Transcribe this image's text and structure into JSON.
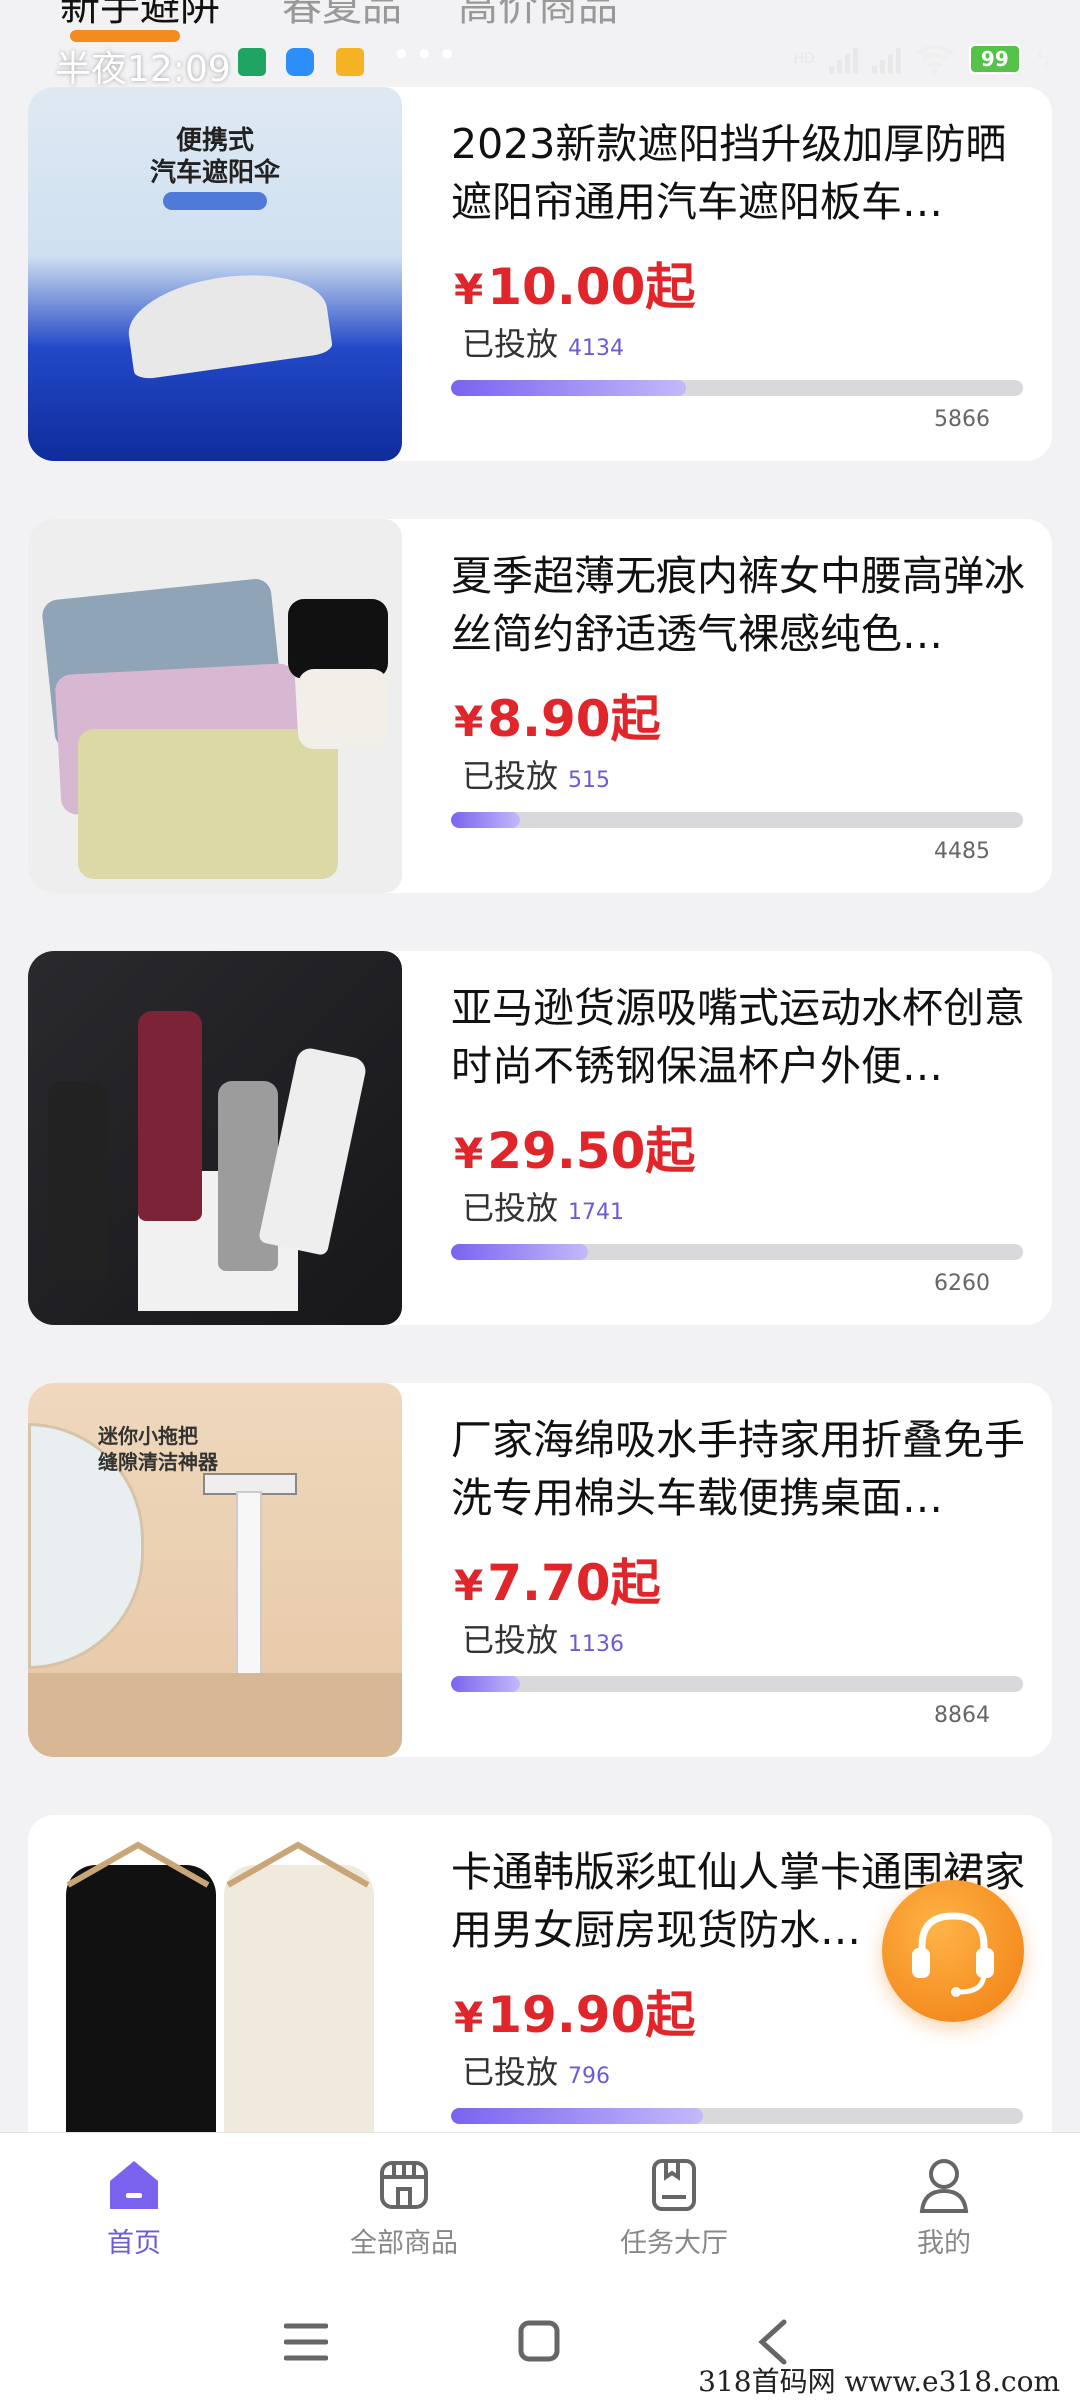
{
  "top_tabs": [
    {
      "label": "新手避阱",
      "active": true
    },
    {
      "label": "春夏品",
      "active": false
    },
    {
      "label": "高价商品",
      "active": false
    }
  ],
  "status_bar": {
    "time": "半夜12:09",
    "battery": "99",
    "network": "HD"
  },
  "products": [
    {
      "title": "2023新款遮阳挡升级加厚防晒遮阳帘通用汽车遮阳板车…",
      "price": "10.00起",
      "placed_label": "已投放",
      "placed_count": "4134",
      "total": "5866",
      "progress": 0.41,
      "image_text": "便携式\n汽车遮阳伞"
    },
    {
      "title": "夏季超薄无痕内裤女中腰高弹冰丝简约舒适透气裸感纯色…",
      "price": "8.90起",
      "placed_label": "已投放",
      "placed_count": "515",
      "total": "4485",
      "progress": 0.12,
      "image_text": ""
    },
    {
      "title": "亚马逊货源吸嘴式运动水杯创意时尚不锈钢保温杯户外便…",
      "price": "29.50起",
      "placed_label": "已投放",
      "placed_count": "1741",
      "total": "6260",
      "progress": 0.24,
      "image_text": ""
    },
    {
      "title": "厂家海绵吸水手持家用折叠免手洗专用棉头车载便携桌面…",
      "price": "7.70起",
      "placed_label": "已投放",
      "placed_count": "1136",
      "total": "8864",
      "progress": 0.12,
      "image_text": "迷你小拖把\n缝隙清洁神器"
    },
    {
      "title": "卡通韩版彩虹仙人掌卡通围裙家用男女厨房现货防水…",
      "price": "19.90起",
      "placed_label": "已投放",
      "placed_count": "796",
      "total": "",
      "progress": 0.44,
      "image_text": ""
    }
  ],
  "currency_symbol": "¥",
  "bottom_nav": [
    {
      "label": "首页",
      "icon": "home-icon",
      "active": true
    },
    {
      "label": "全部商品",
      "icon": "store-icon",
      "active": false
    },
    {
      "label": "任务大厅",
      "icon": "task-icon",
      "active": false
    },
    {
      "label": "我的",
      "icon": "profile-icon",
      "active": false
    }
  ],
  "watermark": "318首码网 www.e318.com",
  "colors": {
    "price": "#e0262b",
    "accent": "#6b5cd6",
    "tab_underline": "#f28c1e",
    "service_button": "#f07d10"
  }
}
